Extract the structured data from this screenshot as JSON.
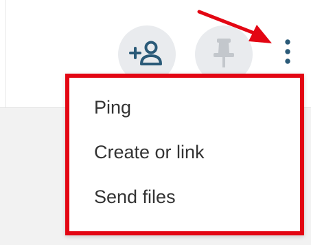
{
  "toolbar": {
    "buttons": [
      {
        "icon": "add-person-icon"
      },
      {
        "icon": "pin-icon"
      },
      {
        "icon": "more-vertical-icon"
      }
    ]
  },
  "menu": {
    "items": [
      {
        "label": "Ping"
      },
      {
        "label": "Create or link"
      },
      {
        "label": "Send files"
      }
    ]
  },
  "colors": {
    "highlight": "#e30613",
    "icon": "#2a5a78",
    "button_bg": "#e9ebee",
    "menu_text": "#333333"
  }
}
